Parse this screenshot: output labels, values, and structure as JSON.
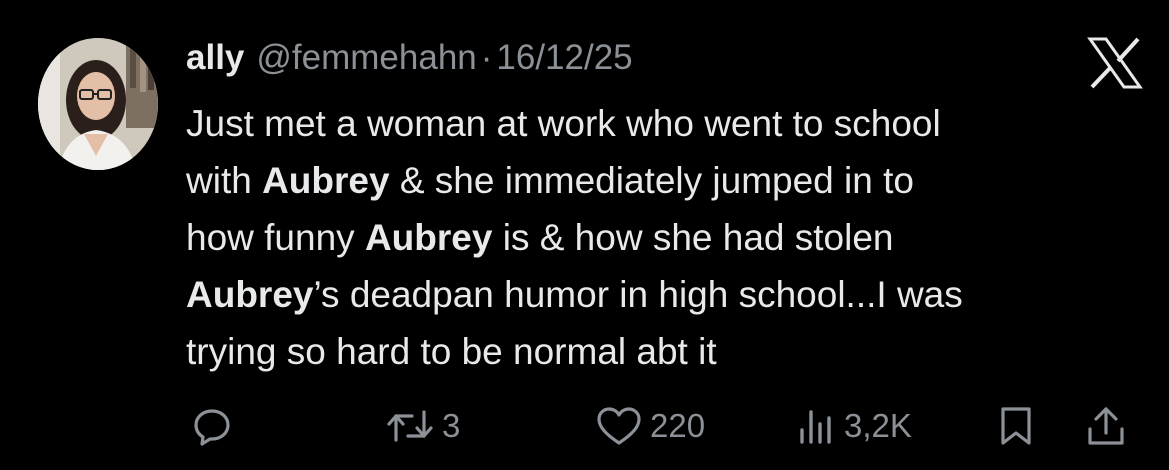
{
  "author": {
    "display_name": "ally",
    "handle": "@femmehahn",
    "separator": "·",
    "date": "16/12/25",
    "avatar_icon": "profile-photo"
  },
  "platform": {
    "logo_icon": "x-logo"
  },
  "tweet": {
    "lines": [
      [
        {
          "t": "Just met a woman at work who went to school",
          "b": false
        }
      ],
      [
        {
          "t": "with ",
          "b": false
        },
        {
          "t": "Aubrey",
          "b": true
        },
        {
          "t": " & she immediately jumped in to",
          "b": false
        }
      ],
      [
        {
          "t": "how funny ",
          "b": false
        },
        {
          "t": "Aubrey",
          "b": true
        },
        {
          "t": " is & how she had stolen",
          "b": false
        }
      ],
      [
        {
          "t": "Aubrey",
          "b": true
        },
        {
          "t": "’s deadpan humor in high school...I was",
          "b": false
        }
      ],
      [
        {
          "t": "trying so hard to be normal abt it",
          "b": false
        }
      ]
    ]
  },
  "actions": {
    "reply": {
      "icon": "reply-icon",
      "count": ""
    },
    "retweet": {
      "icon": "retweet-icon",
      "count": "3"
    },
    "like": {
      "icon": "heart-icon",
      "count": "220"
    },
    "views": {
      "icon": "views-icon",
      "count": "3,2K"
    },
    "bookmark": {
      "icon": "bookmark-icon"
    },
    "share": {
      "icon": "share-icon"
    }
  },
  "colors": {
    "background": "#000000",
    "text": "#e7e9ea",
    "secondary": "#8b9197"
  }
}
